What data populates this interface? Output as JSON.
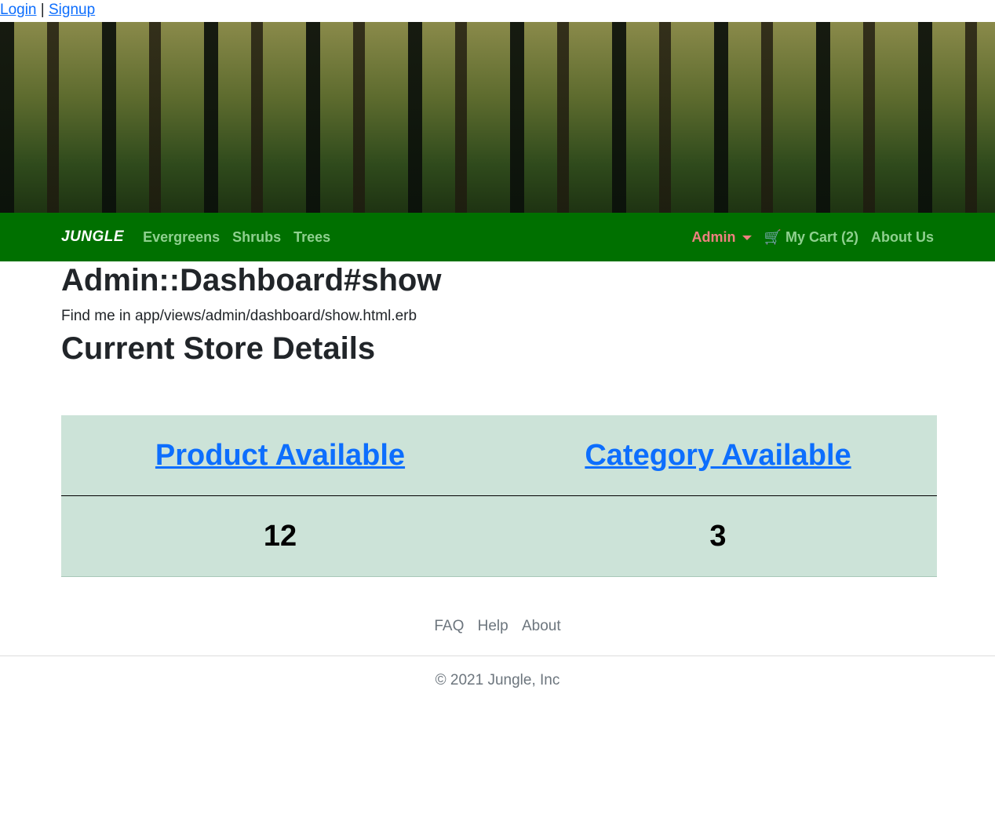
{
  "auth": {
    "login": "Login",
    "sep": "|",
    "signup": "Signup"
  },
  "nav": {
    "brand": "JUNGLE",
    "links": [
      "Evergreens",
      "Shrubs",
      "Trees"
    ],
    "admin": "Admin",
    "cart": "My Cart (2)",
    "about": "About Us"
  },
  "main": {
    "title": "Admin::Dashboard#show",
    "hint": "Find me in app/views/admin/dashboard/show.html.erb",
    "subtitle": "Current Store Details",
    "table": {
      "headers": [
        "Product Available",
        "Category Available"
      ],
      "values": [
        "12",
        "3"
      ]
    }
  },
  "footer": {
    "links": [
      "FAQ",
      "Help",
      "About"
    ],
    "copyright": "© 2021 Jungle, Inc"
  },
  "colors": {
    "nav": "#007000",
    "table": "#cce3d8",
    "admin": "#f08080"
  }
}
